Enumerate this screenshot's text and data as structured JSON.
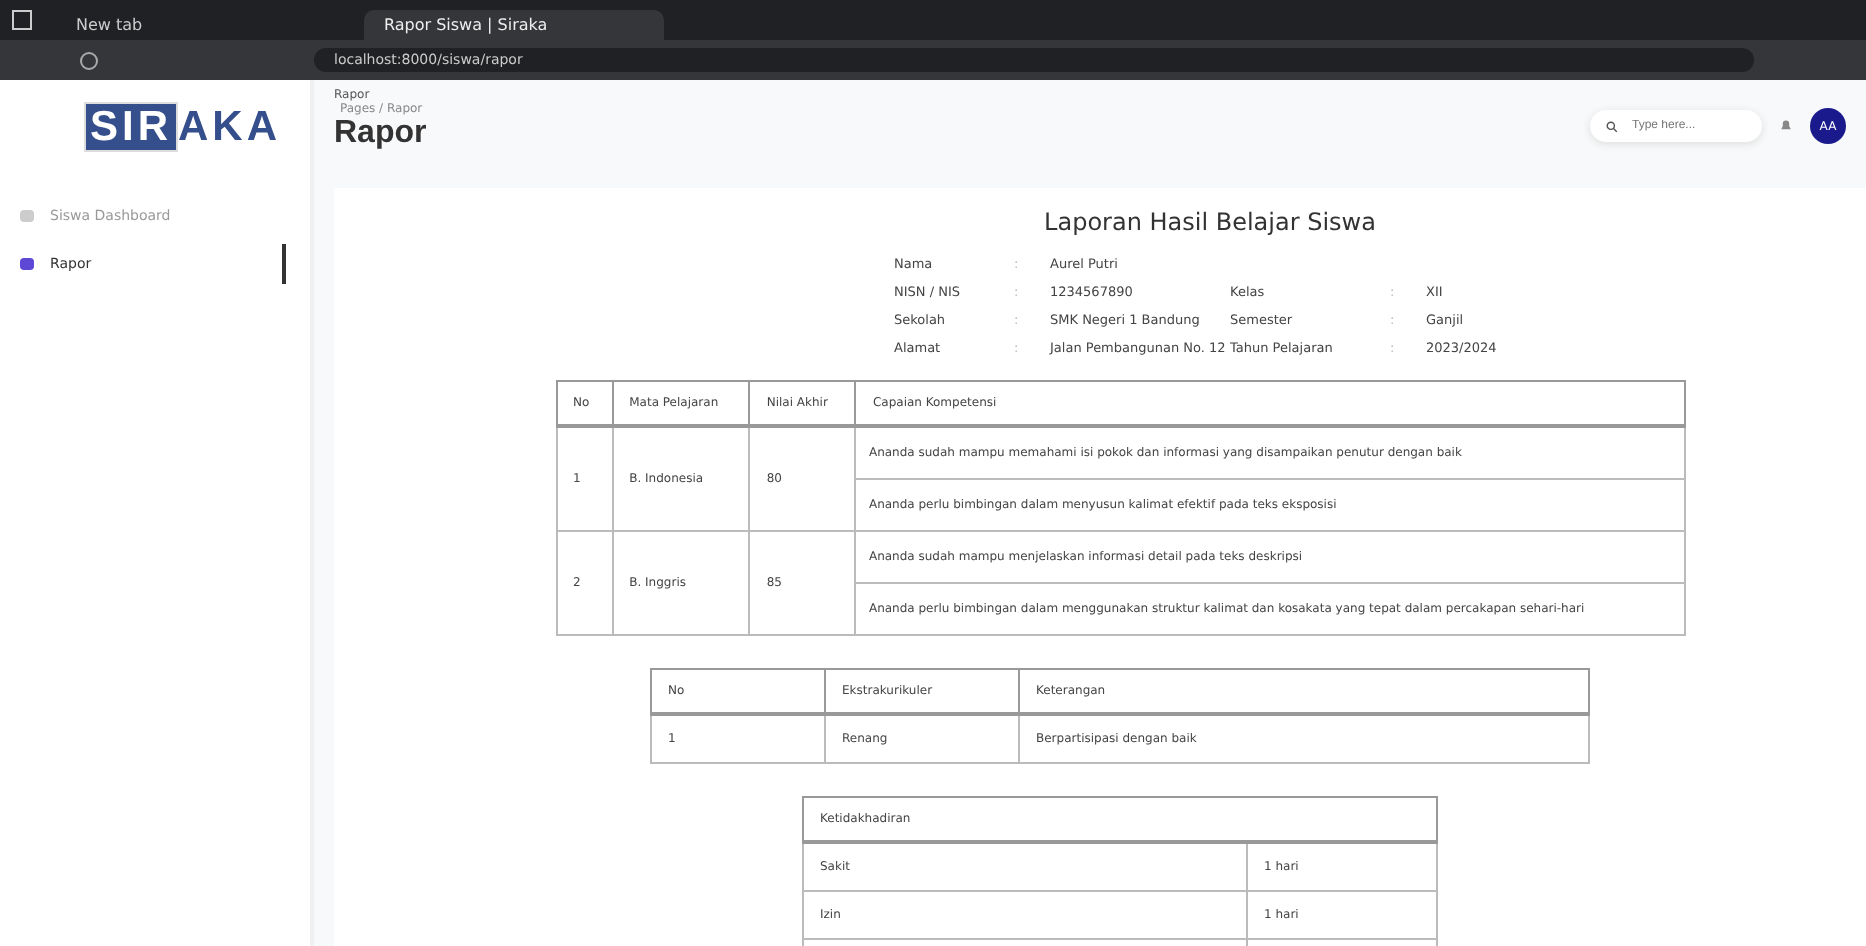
{
  "browser": {
    "tabs": [
      {
        "label": "New tab",
        "selected": false
      },
      {
        "label": "Rapor Siswa | Siraka",
        "selected": true
      }
    ],
    "url": "localhost:8000/siswa/rapor"
  },
  "sidebar": {
    "logo_highlight": "SIR",
    "logo_rest": "AKA",
    "items": [
      {
        "label": "Siswa Dashboard",
        "selected": false
      },
      {
        "label": "Rapor",
        "selected": true
      }
    ]
  },
  "header": {
    "page_label": "Rapor",
    "breadcrumb": "Pages / Rapor",
    "title": "Rapor",
    "search": {
      "placeholder": "Type here..."
    },
    "avatar": "AA"
  },
  "report": {
    "title": "Laporan Hasil Belajar Siswa",
    "info": [
      [
        {
          "label": "Nama",
          "sep": ":",
          "value": "Aurel Putri"
        }
      ],
      [
        {
          "label": "NISN / NIS",
          "sep": ":",
          "value": "1234567890"
        },
        {
          "label": "Kelas",
          "sep": ":",
          "value": "XII"
        }
      ],
      [
        {
          "label": "Sekolah",
          "sep": ":",
          "value": "SMK Negeri 1 Bandung"
        },
        {
          "label": "Semester",
          "sep": ":",
          "value": "Ganjil"
        }
      ],
      [
        {
          "label": "Alamat",
          "sep": ":",
          "value": "Jalan Pembangunan No. 12"
        },
        {
          "label": "Tahun Pelajaran",
          "sep": ":",
          "value": "2023/2024"
        }
      ]
    ],
    "grades": {
      "columns": [
        "No",
        "Mata Pelajaran",
        "Nilai Akhir",
        "Capaian Kompetensi"
      ],
      "rows": [
        {
          "no": "1",
          "subject": "B. Indonesia",
          "score": "80",
          "notes": [
            "Ananda sudah mampu memahami isi pokok dan informasi yang disampaikan penutur dengan baik",
            "Ananda perlu bimbingan dalam menyusun kalimat efektif pada teks eksposisi"
          ]
        },
        {
          "no": "2",
          "subject": "B. Inggris",
          "score": "85",
          "notes": [
            "Ananda sudah mampu menjelaskan informasi detail pada teks deskripsi",
            "Ananda perlu bimbingan dalam menggunakan struktur kalimat dan kosakata yang tepat dalam percakapan sehari-hari"
          ]
        }
      ]
    },
    "extracurricular": {
      "columns": [
        "No",
        "Ekstrakurikuler",
        "Keterangan"
      ],
      "rows": [
        [
          "1",
          "Renang",
          "Berpartisipasi dengan baik"
        ]
      ]
    },
    "attendance": {
      "title": "Ketidakhadiran",
      "rows": [
        [
          "Sakit",
          "1 hari"
        ],
        [
          "Izin",
          "1 hari"
        ]
      ]
    }
  }
}
